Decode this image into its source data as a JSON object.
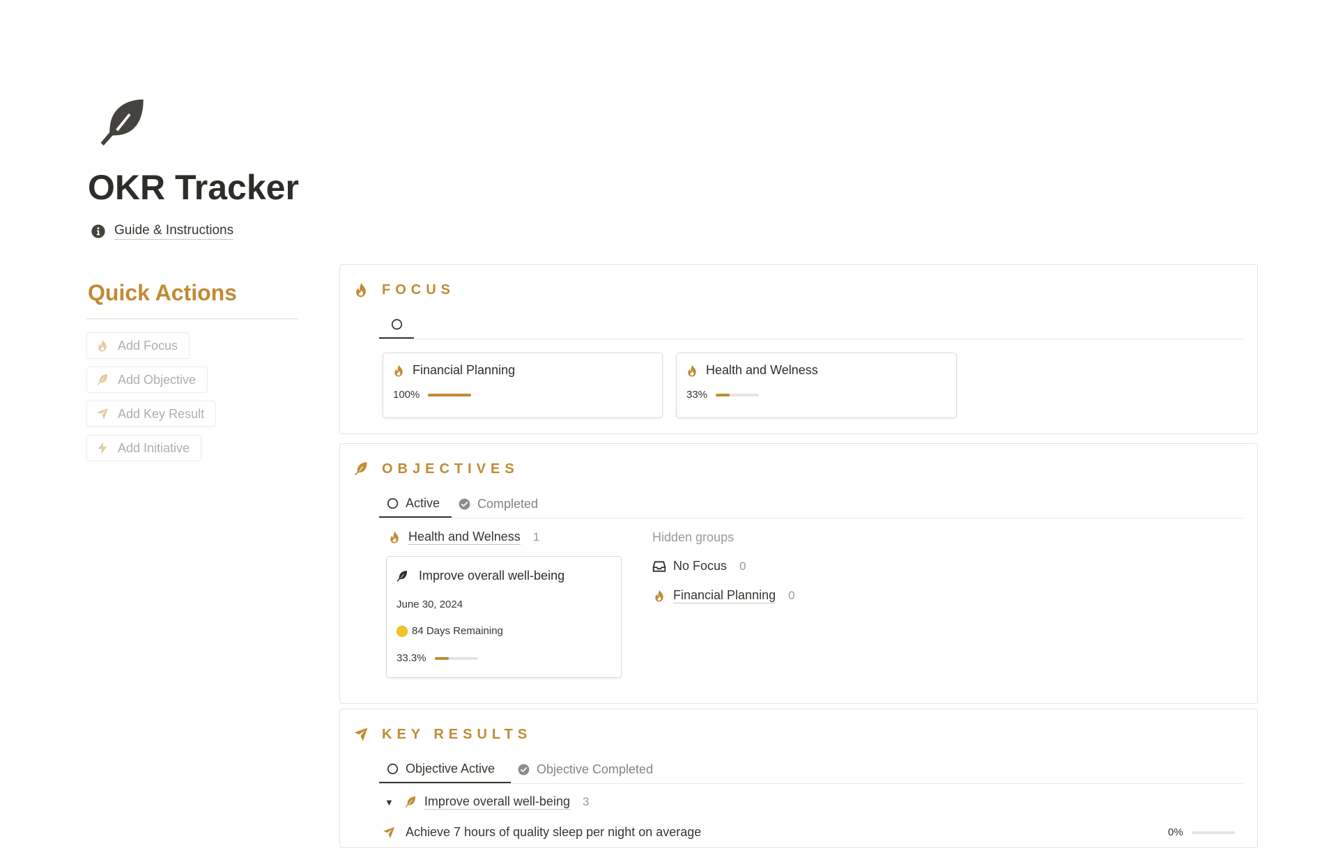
{
  "page": {
    "title": "OKR Tracker",
    "guide_link": "Guide & Instructions",
    "icon": "feather-icon"
  },
  "colors": {
    "accent": "#c08b34",
    "text": "#37352f",
    "muted": "#9b9994"
  },
  "quick_actions": {
    "heading": "Quick Actions",
    "buttons": [
      {
        "label": "Add Focus",
        "icon": "flame-icon"
      },
      {
        "label": "Add Objective",
        "icon": "feather-icon"
      },
      {
        "label": "Add Key Result",
        "icon": "paper-plane-icon"
      },
      {
        "label": "Add Initiative",
        "icon": "lightning-icon"
      }
    ]
  },
  "focus": {
    "title": "FOCUS",
    "tabs": [
      {
        "label": "",
        "icon": "circle-icon",
        "active": true
      }
    ],
    "cards": [
      {
        "name": "Financial Planning",
        "progress_text": "100%",
        "progress": 1.0
      },
      {
        "name": "Health and Welness",
        "progress_text": "33%",
        "progress": 0.33
      }
    ]
  },
  "objectives": {
    "title": "OBJECTIVES",
    "tabs": [
      {
        "label": "Active",
        "icon": "circle-icon",
        "active": true
      },
      {
        "label": "Completed",
        "icon": "check-circle-icon",
        "active": false
      }
    ],
    "group": {
      "label": "Health and Welness",
      "count": "1"
    },
    "card": {
      "title": "Improve overall well-being",
      "date": "June 30, 2024",
      "remaining": "84 Days Remaining",
      "progress_text": "33.3%",
      "progress": 0.333
    },
    "hidden_groups": {
      "heading": "Hidden groups",
      "items": [
        {
          "label": "No Focus",
          "count": "0",
          "icon": "inbox-icon"
        },
        {
          "label": "Financial Planning",
          "count": "0",
          "icon": "flame-icon"
        }
      ]
    }
  },
  "key_results": {
    "title": "KEY RESULTS",
    "tabs": [
      {
        "label": "Objective Active",
        "icon": "circle-icon",
        "active": true
      },
      {
        "label": "Objective Completed",
        "icon": "check-circle-icon",
        "active": false
      }
    ],
    "group": {
      "label": "Improve overall well-being",
      "count": "3"
    },
    "rows": [
      {
        "label": "Achieve 7 hours of quality sleep per night on average",
        "progress_text": "0%",
        "progress": 0
      }
    ]
  }
}
